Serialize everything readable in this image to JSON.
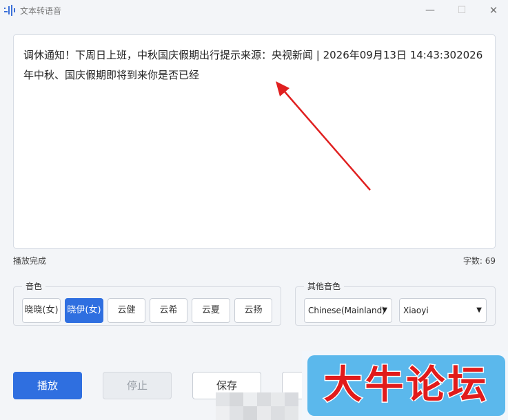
{
  "window": {
    "title": "文本转语音",
    "minimize_glyph": "—",
    "maximize_glyph": "☐",
    "close_glyph": "✕"
  },
  "editor": {
    "text": "调休通知！下周日上班，中秋国庆假期出行提示来源：央视新闻 | 2026年09月13日 14:43:302026年中秋、国庆假期即将到来你是否已经"
  },
  "status": {
    "message": "播放完成",
    "char_count": "字数: 69"
  },
  "voice_group": {
    "legend": "音色",
    "voices": [
      "晓晓(女)",
      "晓伊(女)",
      "云健",
      "云希",
      "云夏",
      "云扬"
    ],
    "selected_index": 1
  },
  "other_voice_group": {
    "legend": "其他音色",
    "language": "Chinese(Mainland)",
    "voice": "Xiaoyi"
  },
  "actions": {
    "play": "播放",
    "stop": "停止",
    "save": "保存"
  },
  "watermark": {
    "text": "大牛论坛"
  },
  "colors": {
    "accent": "#2f6fe0",
    "arrow": "#e02020",
    "watermark_bg": "#5bb8ec",
    "watermark_text": "#e11b1b"
  }
}
